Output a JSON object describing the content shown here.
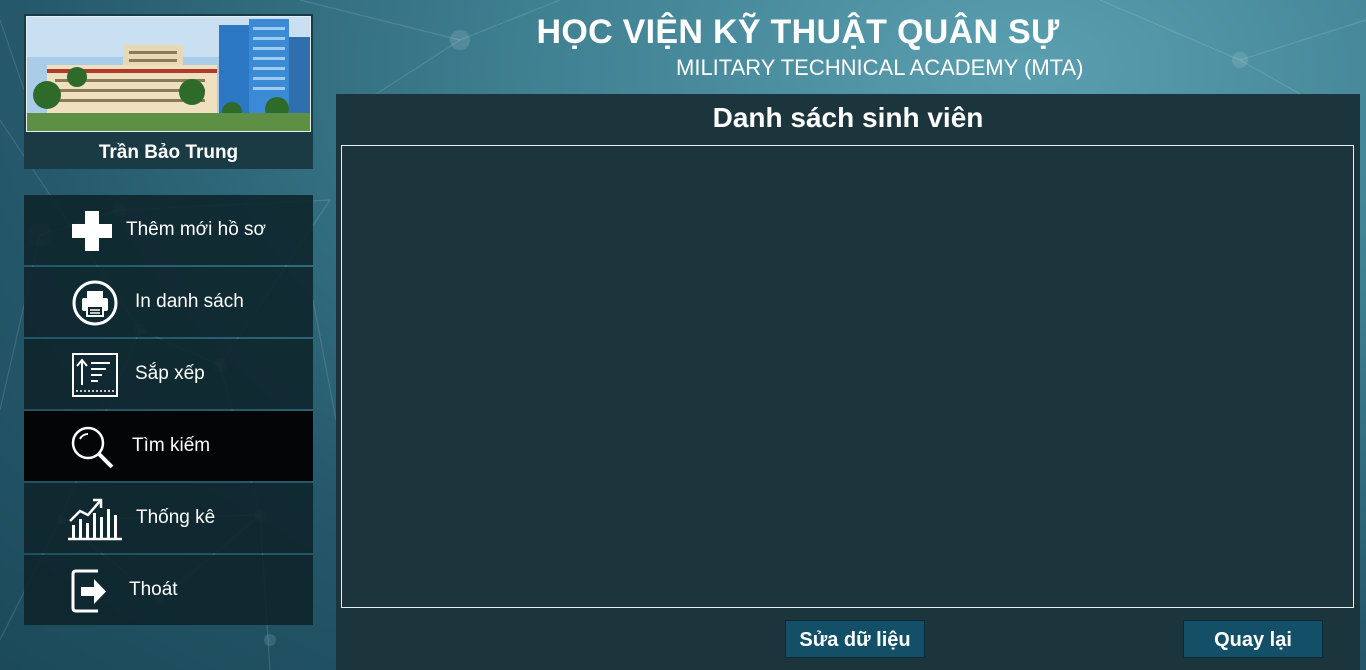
{
  "header": {
    "title": "HỌC VIỆN KỸ THUẬT QUÂN SỰ",
    "subtitle": "MILITARY TECHNICAL ACADEMY (MTA)"
  },
  "profile": {
    "username": "Trần Bảo Trung"
  },
  "menu": {
    "items": [
      {
        "label": "Thêm mới hồ sơ",
        "icon": "plus-icon"
      },
      {
        "label": "In danh sách",
        "icon": "printer-icon"
      },
      {
        "label": "Sắp xếp",
        "icon": "sort-icon"
      },
      {
        "label": "Tìm kiếm",
        "icon": "search-icon"
      },
      {
        "label": "Thống kê",
        "icon": "chart-icon"
      },
      {
        "label": "Thoát",
        "icon": "exit-icon"
      }
    ],
    "active_index": 3
  },
  "main": {
    "title": "Danh sách sinh viên",
    "edit_button": "Sửa dữ liệu",
    "back_button": "Quay lại"
  },
  "colors": {
    "panel": "#1c353c",
    "button": "#134f66",
    "active_menu": "#030507"
  }
}
